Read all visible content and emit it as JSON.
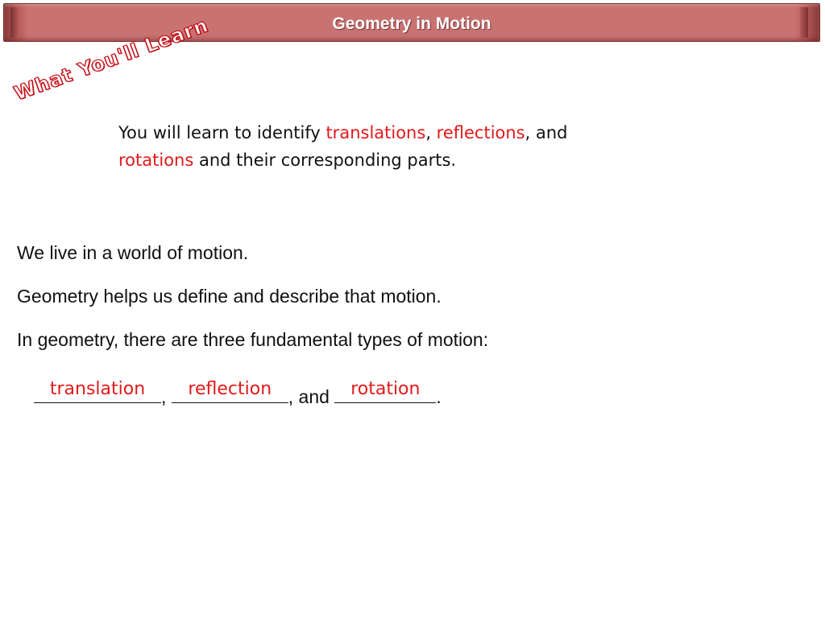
{
  "header": {
    "title": "Geometry in Motion"
  },
  "heading_badge": "What You'll Learn",
  "objective": {
    "intro": "You will learn to identify ",
    "term1": "translations",
    "sep1": ", ",
    "term2": "reflections",
    "sep2": ", and",
    "term3": "rotations",
    "outro": " and their corresponding parts."
  },
  "body": {
    "line1": "We live in a world of motion.",
    "line2": "Geometry helps us define and describe that motion.",
    "line3": "In geometry, there are three fundamental types of motion:"
  },
  "blanks": {
    "answer1": "translation",
    "answer2": "reflection",
    "answer3": "rotation",
    "sep1": ",  ",
    "sep2": ", and ",
    "end": "."
  },
  "colors": {
    "accent_red": "#e01a1a",
    "title_bar": "#c97272"
  }
}
